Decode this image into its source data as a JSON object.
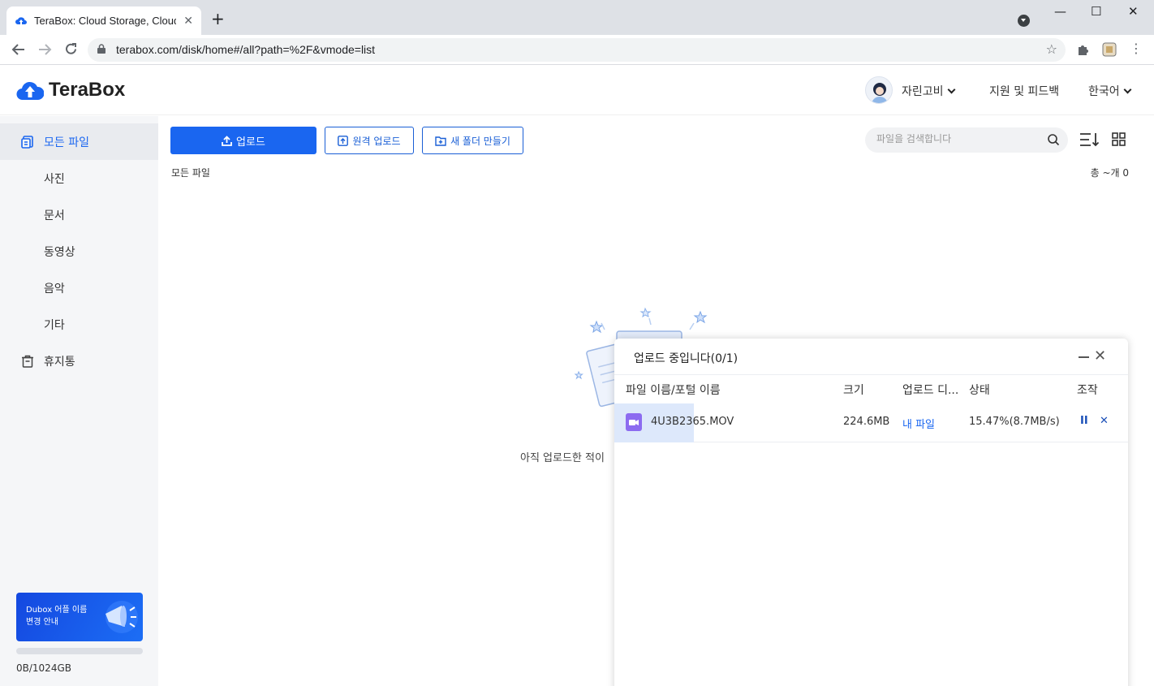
{
  "browser": {
    "tab_title": "TeraBox: Cloud Storage, Cloud St",
    "tab_close": "✕",
    "new_tab": "+",
    "url": "terabox.com/disk/home#/all?path=%2F&vmode=list",
    "win_min": "—",
    "win_max": "☐",
    "win_close": "✕"
  },
  "header": {
    "logo": "TeraBox",
    "username": "자린고비",
    "support": "지원 및 피드백",
    "language": "한국어"
  },
  "sidebar": {
    "items": [
      {
        "label": "모든 파일",
        "icon": "all-files-icon",
        "active": true
      },
      {
        "label": "사진"
      },
      {
        "label": "문서"
      },
      {
        "label": "동영상"
      },
      {
        "label": "음악"
      },
      {
        "label": "기타"
      },
      {
        "label": "휴지통",
        "icon": "trash-icon"
      }
    ],
    "banner": "Dubox 어플 이름 변경 안내",
    "quota": "0B/1024GB"
  },
  "toolbar": {
    "upload": "업로드",
    "remote_upload": "원격 업로드",
    "new_folder": "새 폴더 만들기",
    "search_placeholder": "파일을 검색합니다"
  },
  "content": {
    "breadcrumb": "모든 파일",
    "total": "총 ~개 0",
    "empty_text": "아직 업로드한 적이"
  },
  "upload_panel": {
    "title": "업로드 중입니다(0/1)",
    "columns": [
      "파일 이름/포털 이름",
      "크기",
      "업로드 디...",
      "상태",
      "조작"
    ],
    "rows": [
      {
        "name": "4U3B2365.MOV",
        "size": "224.6MB",
        "destination": "내 파일",
        "status": "15.47%(8.7MB/s)",
        "icon": "video-file-icon"
      }
    ],
    "pause": "II",
    "cancel": "✕"
  },
  "colors": {
    "accent": "#1a66f0",
    "sidebar_bg": "#f5f6f8"
  }
}
